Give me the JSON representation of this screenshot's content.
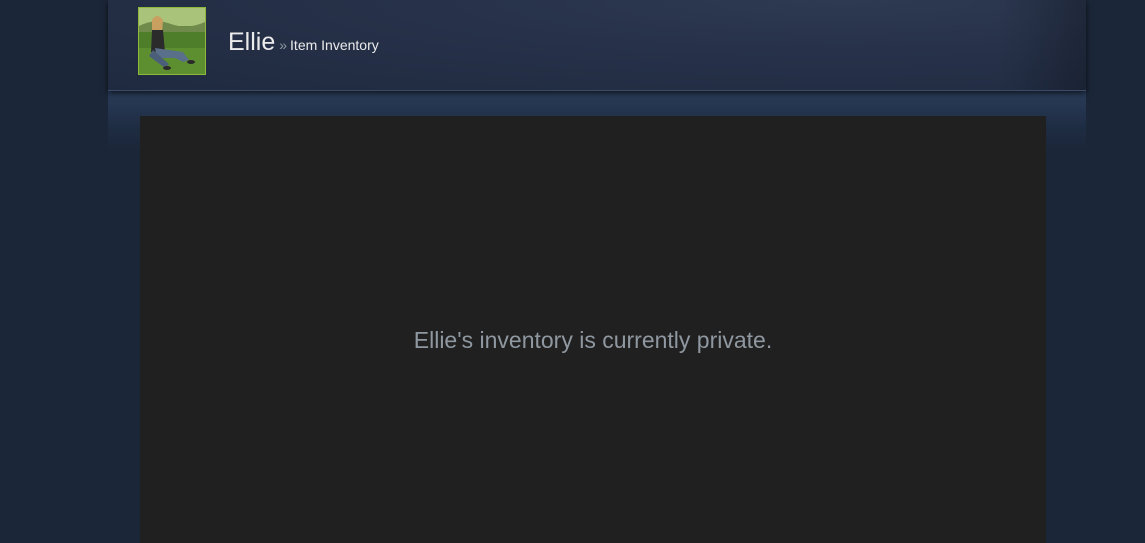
{
  "header": {
    "persona_name": "Ellie",
    "separator": "»",
    "section_title": "Item Inventory",
    "avatar_border_color": "#8fb93b"
  },
  "main": {
    "private_message": "Ellie's inventory is currently private.",
    "panel_color": "#202020",
    "background_color": "#1b2638"
  }
}
